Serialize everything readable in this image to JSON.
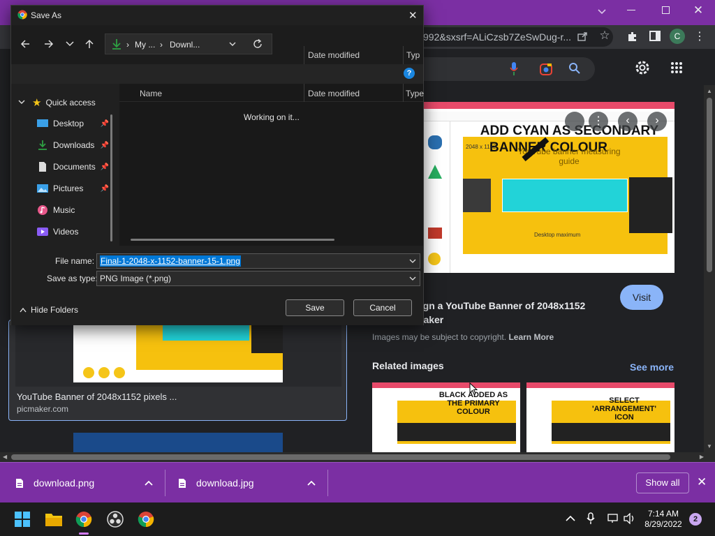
{
  "browser": {
    "url_fragment": "992&sxsrf=ALiCzsb7ZeSwDug-r...",
    "profile_initial": "C"
  },
  "image_panel": {
    "title_line1": "sign a YouTube Banner of 2048x1152",
    "title_line2": "maker",
    "visit_label": "Visit",
    "copyright_text": "Images may be subject to copyright.",
    "learn_more": "Learn More",
    "related_heading": "Related images",
    "see_more": "See more",
    "main_image_text1": "ADD CYAN AS SECONDARY",
    "main_image_text2": "BANNER COLOUR",
    "main_image_sub1": "YouTube banner measuring",
    "main_image_sub2": "guide",
    "main_image_size": "2048 x 1152",
    "main_image_desktop": "Desktop maximum",
    "related1_line1": "BLACK ADDED AS",
    "related1_line2": "THE PRIMARY",
    "related1_line3": "COLOUR",
    "related2_line1": "SELECT",
    "related2_line2": "'ARRANGEMENT'",
    "related2_line3": "ICON"
  },
  "left_result": {
    "title": "YouTube Banner of 2048x1152 pixels ...",
    "source": "picmaker.com"
  },
  "dialog": {
    "title": "Save As",
    "breadcrumb_1": "My ...",
    "breadcrumb_2": "Downl...",
    "col_name": "Name",
    "col_date": "Date modified",
    "col_type": "Type",
    "col_date_ghost": "Date modified",
    "col_type_ghost": "Typ",
    "status": "Working on it...",
    "quick_access": "Quick access",
    "nav_items": [
      "Desktop",
      "Downloads",
      "Documents",
      "Pictures",
      "Music",
      "Videos"
    ],
    "file_name_label": "File name:",
    "file_name_value": "Final-1-2048-x-1152-banner-15-1.png",
    "save_type_label": "Save as type:",
    "save_type_value": "PNG Image (*.png)",
    "hide_folders": "Hide Folders",
    "save_button": "Save",
    "cancel_button": "Cancel",
    "help_glyph": "?"
  },
  "downloads": {
    "items": [
      "download.png",
      "download.jpg"
    ],
    "show_all": "Show all"
  },
  "taskbar": {
    "time": "7:14 AM",
    "date": "8/29/2022",
    "notification_count": "2"
  },
  "colors": {
    "chrome_accent": "#7b2fa3",
    "selection_blue": "#0078d7",
    "visit_button": "#8ab4f8"
  }
}
